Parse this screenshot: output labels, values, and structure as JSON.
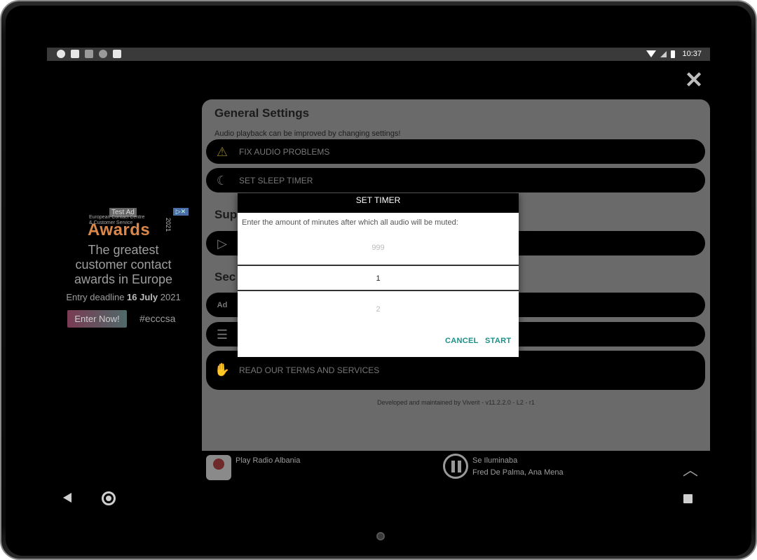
{
  "status_bar": {
    "time": "10:37"
  },
  "ad": {
    "test_label": "Test Ad",
    "choices_label": "▷✕",
    "org_line1": "European Contact Centre",
    "org_line2": "& Customer Service",
    "brand": "Awards",
    "year": "2021",
    "headline": "The greatest customer contact awards in Europe",
    "deadline_prefix": "Entry deadline ",
    "deadline_date": "16 July",
    "deadline_year": " 2021",
    "cta": "Enter Now!",
    "hashtag": "#ecccsa"
  },
  "settings": {
    "title": "General Settings",
    "subtitle": "Audio playback can be improved by changing settings!",
    "items": [
      {
        "label": "FIX AUDIO PROBLEMS",
        "icon": "warning-icon"
      },
      {
        "label": "SET SLEEP TIMER",
        "icon": "sleep-moon-icon"
      },
      {
        "label": "",
        "icon": "play-store-icon"
      },
      {
        "label": "",
        "icon": "ad-icon"
      },
      {
        "label": "",
        "icon": "clipboard-icon"
      },
      {
        "label": "READ OUR TERMS AND SERVICES",
        "icon": "handshake-icon"
      }
    ],
    "section2_partial": "Sup",
    "section3_partial": "Sec",
    "developer_note": "Developed and maintained by Viverit - v11.2.2.0 - L2 - r1"
  },
  "player": {
    "station_name": "Play Radio Albania",
    "track_title": "Se Iluminaba",
    "track_artist": "Fred De Palma, Ana Mena"
  },
  "dialog": {
    "title": "SET TIMER",
    "message": "Enter the amount of minutes after which all audio will be muted:",
    "picker_prev": "999",
    "picker_selected": "1",
    "picker_next": "2",
    "cancel_label": "CANCEL",
    "start_label": "START"
  },
  "colors": {
    "accent": "#1a8f87",
    "panel_dimmed": "#6a6a6a"
  }
}
